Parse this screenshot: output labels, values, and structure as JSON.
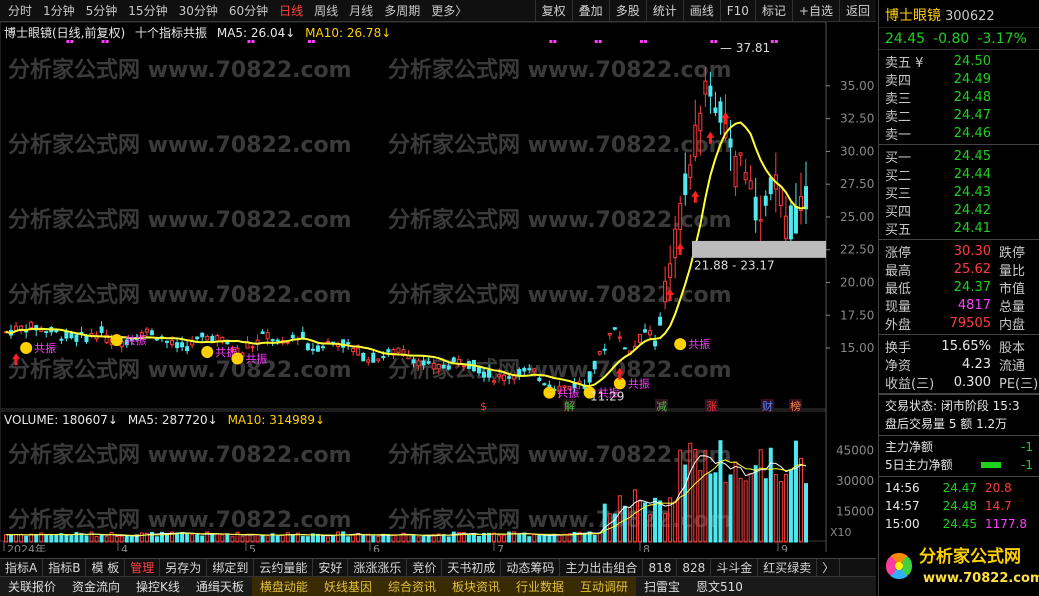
{
  "toolbar": {
    "periods": [
      "分时",
      "1分钟",
      "5分钟",
      "15分钟",
      "30分钟",
      "60分钟",
      "日线",
      "周线",
      "月线",
      "多周期",
      "更多〉"
    ],
    "active_period": "日线",
    "tools": [
      "复权",
      "叠加",
      "多股",
      "统计",
      "画线",
      "F10",
      "标记",
      "+自选",
      "返回"
    ]
  },
  "main_legend": {
    "name": "博士眼镜(日线,前复权)",
    "indicator": "十个指标共振",
    "ma5_label": "MA5: 26.04↓",
    "ma10_label": "MA10: 26.78↓"
  },
  "volume_legend": {
    "volume_label": "VOLUME: 180607↓",
    "ma5_label": "MA5: 287720↓",
    "ma10_label": "MA10: 314989↓"
  },
  "price_axis": [
    "35.00",
    "32.50",
    "30.00",
    "27.50",
    "25.00",
    "22.50",
    "20.00",
    "17.50",
    "15.00"
  ],
  "volume_axis": [
    "45000",
    "30000",
    "15000"
  ],
  "volume_unit": "X10",
  "date_axis": [
    "2024年",
    "4",
    "5",
    "6",
    "7",
    "8",
    "9"
  ],
  "annotations": {
    "high": "37.81",
    "low": "11.29",
    "range": "21.88 - 23.17",
    "signal": "共振",
    "events": [
      "$",
      "解",
      "减",
      "涨",
      "财",
      "榜"
    ]
  },
  "watermark": "分析家公式网 www.70822.com",
  "colors": {
    "up": "#ff3c3c",
    "down": "#4fe8f0",
    "ma5": "#ffffff",
    "ma10": "#ffff33",
    "accent": "#ffd000"
  },
  "tabs_row1": [
    "指标A",
    "指标B",
    "模 板",
    "管理",
    "另存为",
    "绑定到",
    "云约量能",
    "安好",
    "涨涨涨乐",
    "竞价",
    "天书初成",
    "动态筹码",
    "主力出击组合",
    "818",
    "828",
    "斗斗金",
    "红买绿卖",
    "〉"
  ],
  "tabs_row1_active": "管理",
  "tabs_row2": [
    "关联报价",
    "资金流向",
    "操控K线",
    "通缉天板",
    "横盘动能",
    "妖线基因",
    "综合资讯",
    "板块资讯",
    "行业数据",
    "互动调研",
    "扫雷宝",
    "恩文510"
  ],
  "stock": {
    "name": "博士眼镜",
    "code": "300622",
    "price": "24.45",
    "change": "-0.80",
    "change_pct": "-3.17%"
  },
  "asks": [
    {
      "label": "卖五 ¥",
      "price": "24.50"
    },
    {
      "label": "卖四",
      "price": "24.49"
    },
    {
      "label": "卖三",
      "price": "24.48"
    },
    {
      "label": "卖二",
      "price": "24.47"
    },
    {
      "label": "卖一",
      "price": "24.46"
    }
  ],
  "bids": [
    {
      "label": "买一",
      "price": "24.45"
    },
    {
      "label": "买二",
      "price": "24.44"
    },
    {
      "label": "买三",
      "price": "24.43"
    },
    {
      "label": "买四",
      "price": "24.42"
    },
    {
      "label": "买五",
      "price": "24.41"
    }
  ],
  "stats": [
    {
      "label": "涨停",
      "value": "30.30",
      "label2": "跌停"
    },
    {
      "label": "最高",
      "value": "25.62",
      "label2": "量比"
    },
    {
      "label": "最低",
      "value": "24.37",
      "label2": "市值"
    },
    {
      "label": "现量",
      "value": "4817",
      "label2": "总量"
    },
    {
      "label": "外盘",
      "value": "79505",
      "label2": "内盘"
    }
  ],
  "stats2": [
    {
      "label": "换手",
      "value": "15.65%",
      "label2": "股本"
    },
    {
      "label": "净资",
      "value": "4.23",
      "label2": "流通"
    },
    {
      "label": "收益(三)",
      "value": "0.300",
      "label2": "PE(三)"
    }
  ],
  "status": {
    "line1": "交易状态: 闭市阶段 15:3",
    "line2": "盘后交易量 5 额 1.2万"
  },
  "flow": {
    "main_net": "主力净额",
    "main_net_val": "-1",
    "five_day": "5日主力净额",
    "five_day_val": "-1"
  },
  "ticks": [
    {
      "time": "14:56",
      "price": "24.47",
      "vol": "20.8"
    },
    {
      "time": "14:57",
      "price": "24.48",
      "vol": "14.7"
    },
    {
      "time": "15:00",
      "price": "24.45",
      "vol": "1177.8"
    }
  ],
  "logo": {
    "title": "分析家公式网",
    "url": "www.70822.com"
  }
}
